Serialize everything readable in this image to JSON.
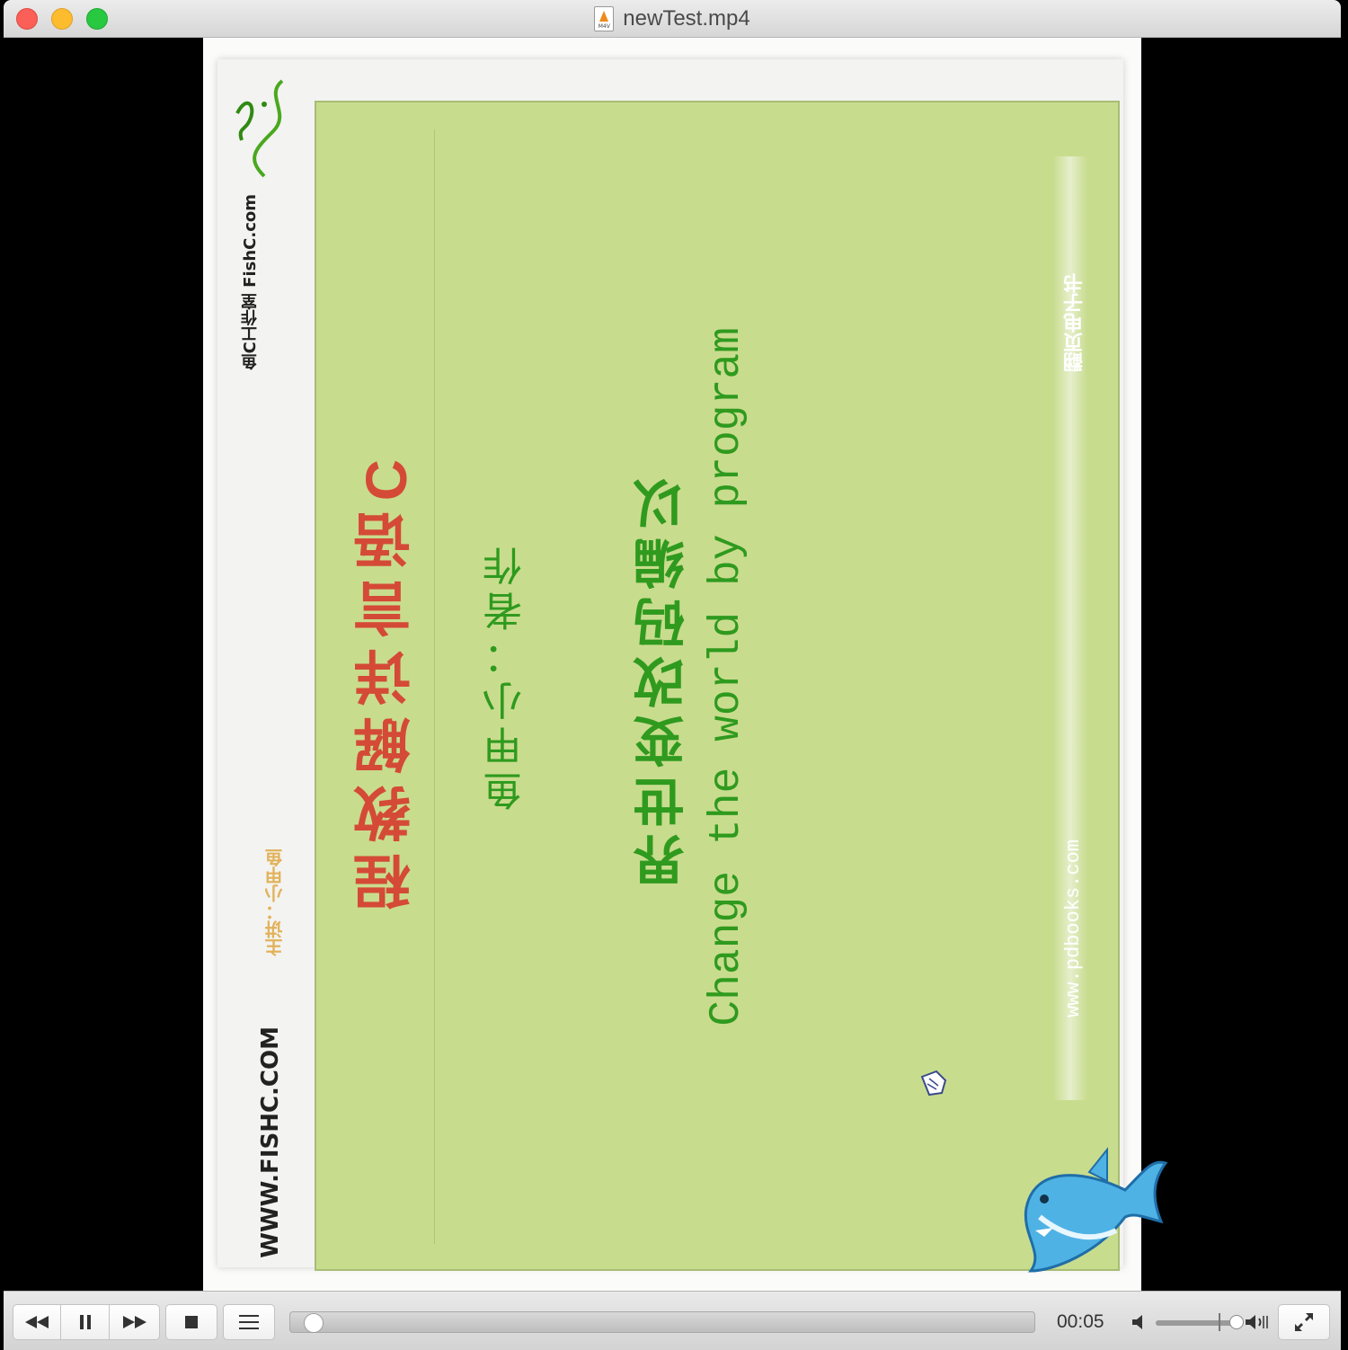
{
  "window": {
    "title": "newTest.mp4",
    "file_icon_tag": "M4V"
  },
  "video_frame": {
    "strip_top": "翻页电子书",
    "strip_bottom": "www.pdbooks.com",
    "english": "Change the world by program",
    "title_zh": "界世变改码编以",
    "author": "鱼甲小：者作",
    "red_zh": "程教解详言语C",
    "logo_text": "鱼C工作室 FishC.com",
    "bottom_url": "WWW.FISHC.COM",
    "sub_url": "主讲：小甲鱼"
  },
  "controls": {
    "time": "00:05",
    "seek_position": 0.005,
    "volume_level": 0.92
  },
  "colors": {
    "panel_green": "#c8dc8e",
    "text_green": "#2f9a1e",
    "text_red": "#d44a36"
  },
  "icons": [
    "rewind-icon",
    "pause-icon",
    "fast-forward-icon",
    "stop-icon",
    "playlist-icon",
    "volume-low-icon",
    "volume-high-icon",
    "fullscreen-icon",
    "hand-cursor-icon",
    "shark-logo"
  ]
}
